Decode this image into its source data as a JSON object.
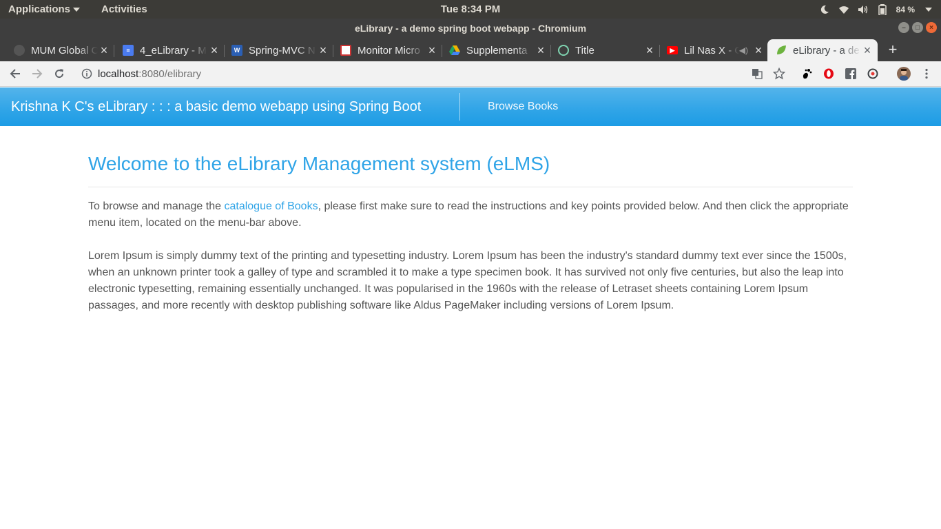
{
  "system_bar": {
    "applications_label": "Applications",
    "activities_label": "Activities",
    "clock": "Tue  8:34 PM",
    "battery_percent": "84 %"
  },
  "window": {
    "title": "eLibrary - a demo spring boot webapp - Chromium"
  },
  "tabs": [
    {
      "label": "MUM Global C",
      "favicon": "mum-globe-icon",
      "color": "#555555"
    },
    {
      "label": "4_eLibrary - M",
      "favicon": "google-docs-icon",
      "color": "#4a7bf0"
    },
    {
      "label": "Spring-MVC N",
      "favicon": "word-doc-icon",
      "color": "#2b5fb4"
    },
    {
      "label": "Monitor Micro",
      "favicon": "monitor-app-icon",
      "color": "#ffffff"
    },
    {
      "label": "Supplementa",
      "favicon": "google-drive-icon",
      "color": "#f2b300"
    },
    {
      "label": "Title",
      "favicon": "loading-spinner-icon",
      "color": "#7fd3b0"
    },
    {
      "label": "Lil Nas X - O",
      "favicon": "youtube-icon",
      "color": "#ff0000"
    },
    {
      "label": "eLibrary - a de",
      "favicon": "spring-leaf-icon",
      "color": "#6db33f",
      "active": true
    }
  ],
  "address_bar": {
    "host": "localhost",
    "path": ":8080/elibrary"
  },
  "app": {
    "brand": "Krishna K C's eLibrary : : : a basic demo webapp using Spring Boot",
    "nav_browse_books": "Browse Books",
    "heading": "Welcome to the eLibrary Management system (eLMS)",
    "intro_before_link": "To browse and manage the ",
    "intro_link": "catalogue of Books",
    "intro_after_link": ", please first make sure to read the instructions and key points provided below. And then click the appropriate menu item, located on the menu-bar above.",
    "lorem": "Lorem Ipsum is simply dummy text of the printing and typesetting industry. Lorem Ipsum has been the industry's standard dummy text ever since the 1500s, when an unknown printer took a galley of type and scrambled it to make a type specimen book. It has survived not only five centuries, but also the leap into electronic typesetting, remaining essentially unchanged. It was popularised in the 1960s with the release of Letraset sheets containing Lorem Ipsum passages, and more recently with desktop publishing software like Aldus PageMaker including versions of Lorem Ipsum."
  },
  "colors": {
    "accent": "#2fa4e7",
    "body_text": "#555555"
  }
}
